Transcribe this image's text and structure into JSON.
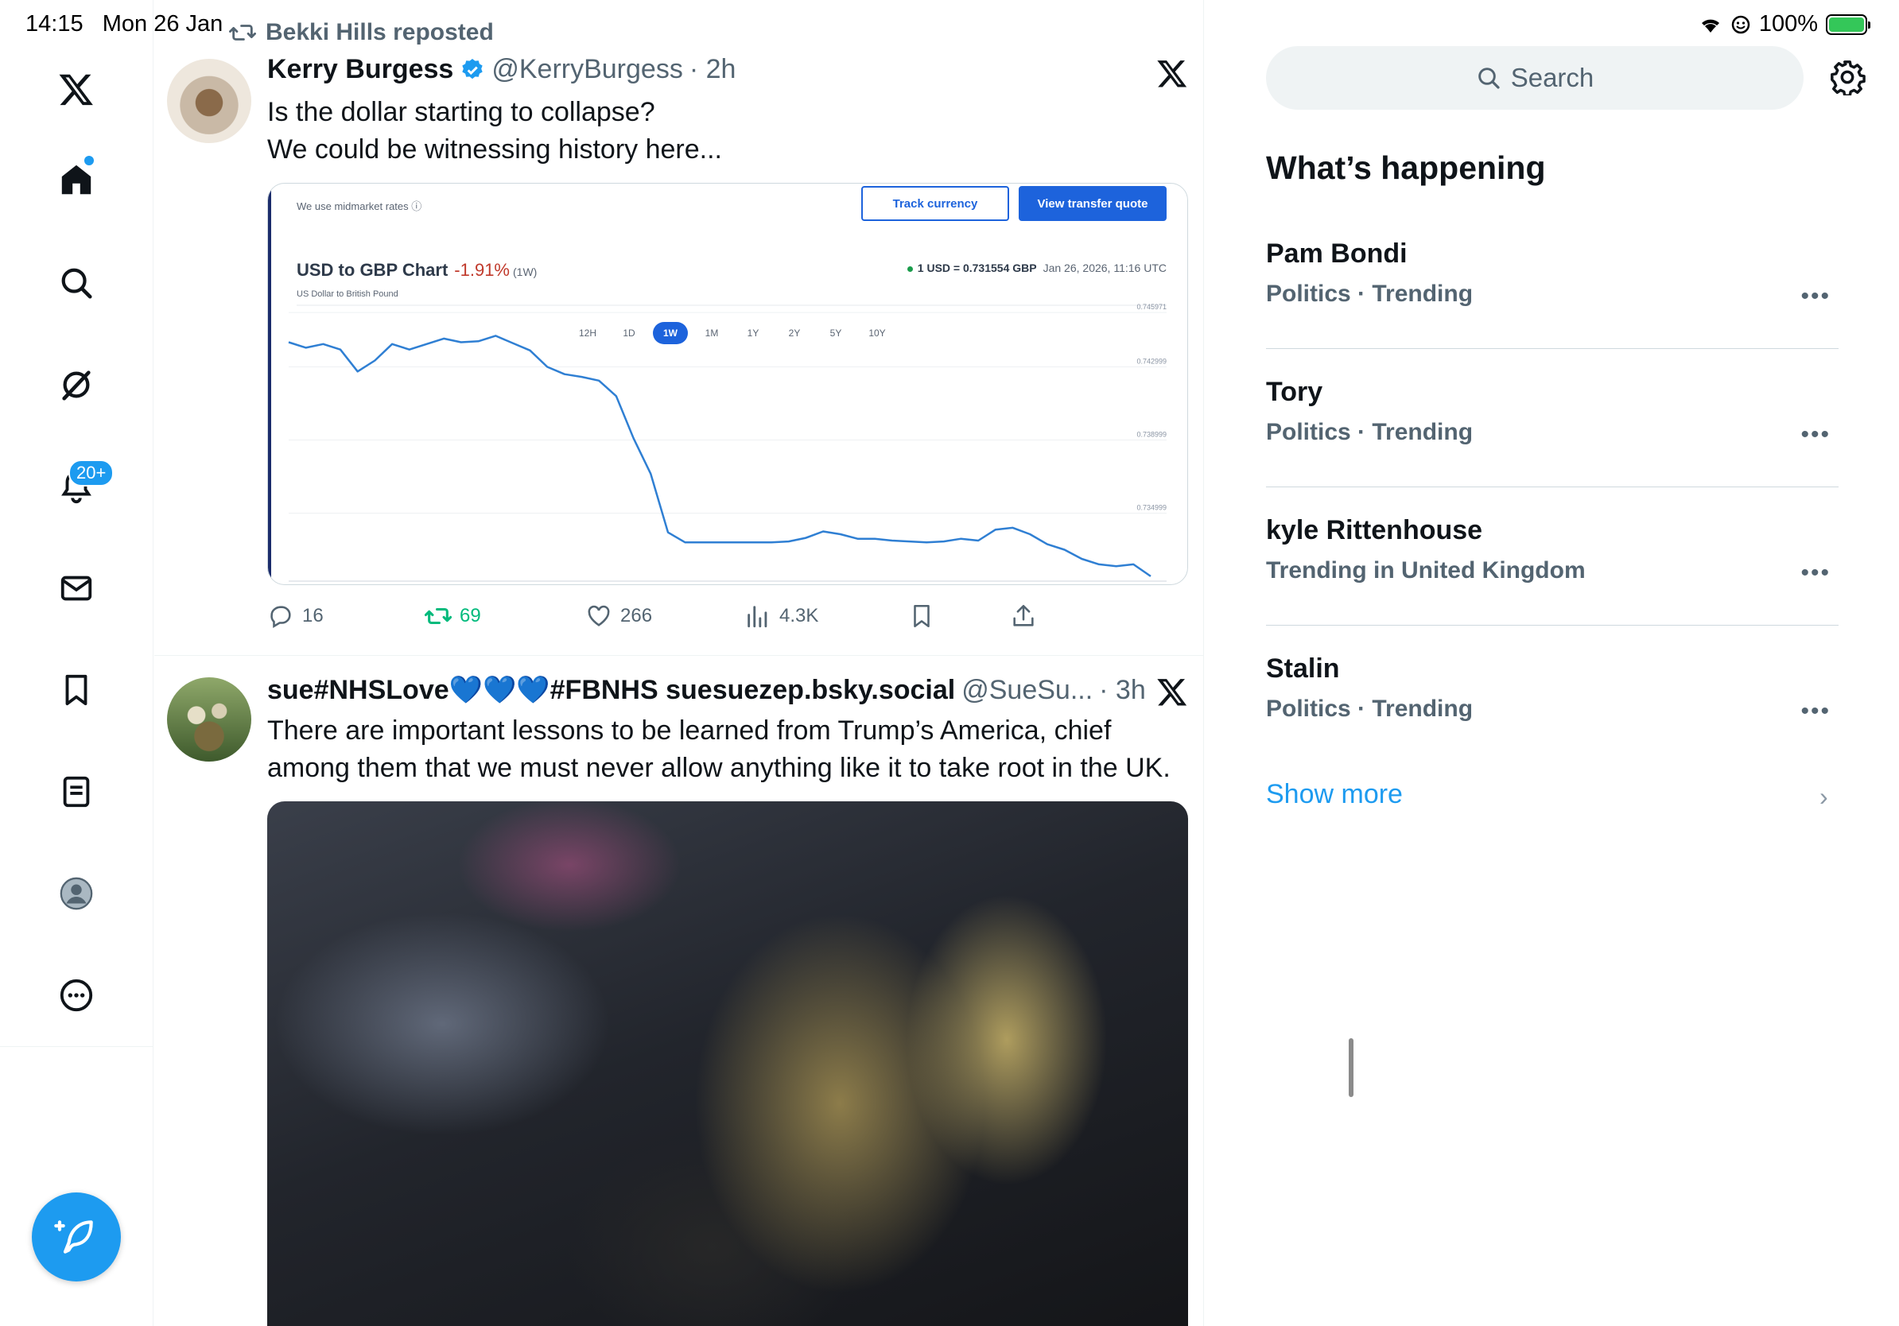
{
  "status_bar": {
    "time": "14:15",
    "date": "Mon 26 Jan",
    "battery": "100%",
    "icons": [
      "wifi-icon",
      "focus-icon",
      "battery-charging-icon"
    ]
  },
  "nav": {
    "items": [
      "x-logo-icon",
      "home-icon",
      "explore-icon",
      "grok-icon",
      "notifications-icon",
      "messages-icon",
      "bookmarks-icon",
      "lists-icon",
      "profile-icon",
      "more-icon"
    ],
    "notification_badge": "20+",
    "compose_icon": "compose-post-icon"
  },
  "feed": {
    "repost_banner": "Bekki Hills reposted",
    "tweets": [
      {
        "name": "Kerry Burgess",
        "handle": "@KerryBurgess",
        "time": "· 2h",
        "verified": true,
        "lines": [
          "Is the dollar starting to collapse?",
          "We could be witnessing history here..."
        ],
        "card": {
          "midmarket": "We use midmarket rates ⓘ",
          "track_button": "Track currency",
          "view_button": "View transfer quote",
          "title": "USD to GBP Chart",
          "change": "-1.91%",
          "period": "(1W)",
          "subtitle": "US Dollar to British Pound",
          "rate": "1 USD = 0.731554 GBP",
          "timestamp": "Jan 26, 2026, 11:16 UTC",
          "ranges": [
            "12H",
            "1D",
            "1W",
            "1M",
            "1Y",
            "2Y",
            "5Y",
            "10Y"
          ],
          "active_range": "1W"
        },
        "stats": {
          "replies": "16",
          "reposts": "69",
          "likes": "266",
          "views": "4.3K"
        }
      },
      {
        "name": "sue#NHSLove💙💙💙#FBNHS suesuezep.bsky.social",
        "handle": "@SueSu...",
        "time": "· 3h",
        "lines": [
          "There are important lessons to be learned from Trump’s America, chief",
          "among them that we must never allow anything like it to take root in the UK."
        ]
      }
    ]
  },
  "sidebar": {
    "search_placeholder": "Search",
    "section_title": "What’s happening",
    "trends": [
      {
        "name": "Pam Bondi",
        "meta": "Politics · Trending"
      },
      {
        "name": "Tory",
        "meta": "Politics · Trending"
      },
      {
        "name": "kyle Rittenhouse",
        "meta": "Trending in United Kingdom"
      },
      {
        "name": "Stalin",
        "meta": "Politics · Trending"
      }
    ],
    "show_more": "Show more",
    "more_glyph": "•••"
  },
  "colors": {
    "accent": "#1d9bf0",
    "repost_green": "#00ba7c",
    "chart_line": "#2f7fd3",
    "chart_change_red": "#c0392b",
    "card_button_blue": "#1d63dc"
  },
  "chart_data": {
    "type": "line",
    "title": "USD to GBP Chart",
    "subtitle": "US Dollar to British Pound",
    "series": [
      {
        "name": "",
        "x": [
          0,
          4,
          8,
          12,
          16,
          20,
          24,
          28,
          32,
          36,
          40,
          44,
          48,
          52,
          56,
          60,
          64,
          68,
          72,
          76,
          80,
          84,
          88,
          92,
          96,
          100,
          104,
          108,
          112,
          116,
          120,
          124,
          128,
          132,
          136,
          140,
          144,
          148,
          152,
          156,
          160,
          164,
          168,
          172,
          176,
          180,
          184,
          188,
          192,
          196,
          200
        ],
        "values": [
          0.74435,
          0.74405,
          0.74425,
          0.74395,
          0.74275,
          0.74335,
          0.74425,
          0.74395,
          0.74425,
          0.74455,
          0.74435,
          0.7444,
          0.7447,
          0.7443,
          0.7439,
          0.743,
          0.7426,
          0.74245,
          0.74225,
          0.7414,
          0.7391,
          0.73715,
          0.73395,
          0.7334,
          0.7334,
          0.7334,
          0.7334,
          0.7334,
          0.7334,
          0.73345,
          0.73365,
          0.734,
          0.73385,
          0.7336,
          0.7336,
          0.7335,
          0.73345,
          0.7334,
          0.73345,
          0.7336,
          0.7335,
          0.7341,
          0.7342,
          0.73385,
          0.7333,
          0.733,
          0.7325,
          0.7322,
          0.7321,
          0.7322,
          0.73155
        ]
      }
    ],
    "y_ticks": [
      "0.745971",
      "0.742999",
      "0.738999",
      "0.734999"
    ],
    "ylim": [
      0.7315,
      0.7465
    ],
    "grid": true
  }
}
